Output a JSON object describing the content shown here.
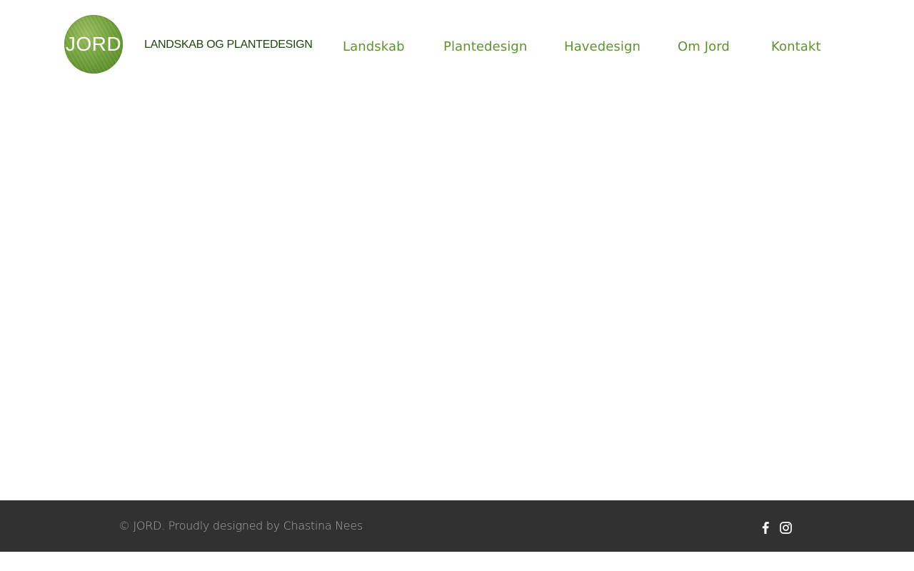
{
  "header": {
    "logo_text": "JORD",
    "tagline": "LANDSKAB OG PLANTEDESIGN",
    "nav": [
      {
        "label": "Landskab"
      },
      {
        "label": "Plantedesign"
      },
      {
        "label": "Havedesign"
      },
      {
        "label": "Om Jord"
      },
      {
        "label": "Kontakt"
      }
    ]
  },
  "footer": {
    "copyright": "© JORD. Proudly designed by Chastina Nees",
    "social": [
      {
        "icon": "facebook-icon"
      },
      {
        "icon": "instagram-icon"
      }
    ]
  },
  "colors": {
    "nav_text": "#5f9134",
    "tagline_text": "#1e4410",
    "logo_green": "#679a33",
    "footer_bg": "#313131",
    "footer_text": "#a8a8a8"
  }
}
